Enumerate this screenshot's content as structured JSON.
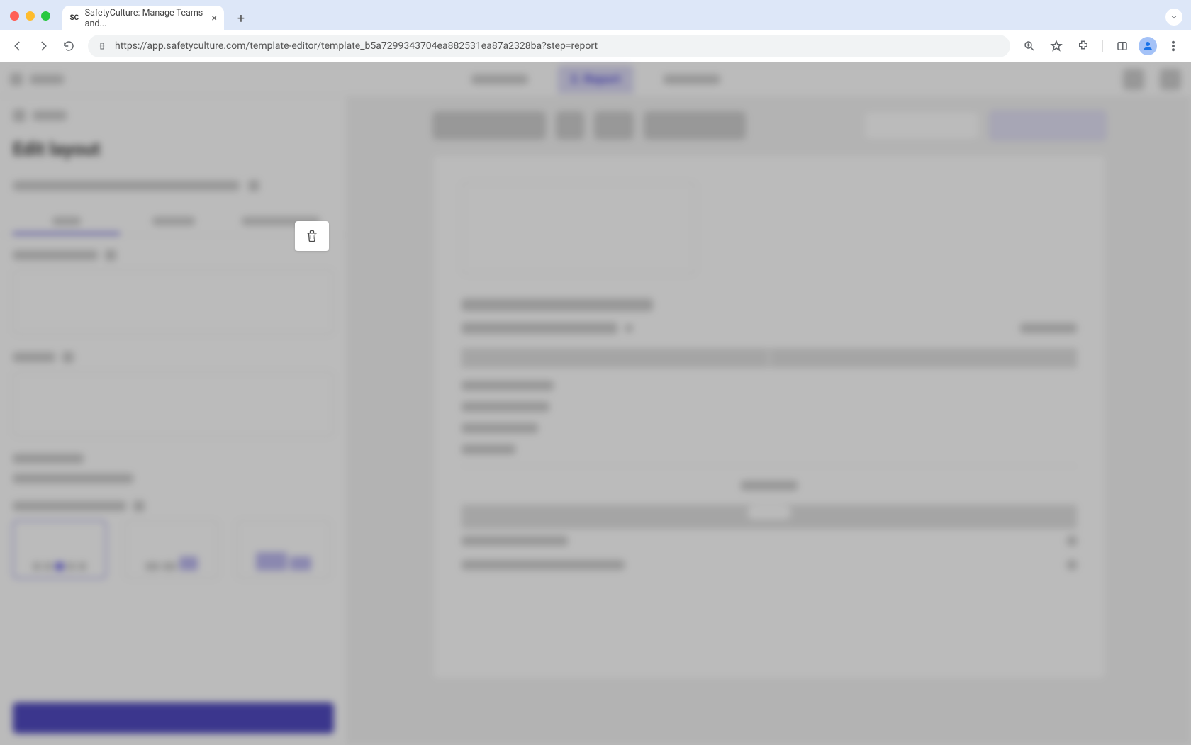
{
  "browser": {
    "tab_title": "SafetyCulture: Manage Teams and...",
    "favicon_text": "SC",
    "url": "https://app.safetyculture.com/template-editor/template_b5a7299343704ea882531ea87a2328ba?step=report"
  },
  "app": {
    "active_step_label": "2. Report",
    "sidebar_title": "Edit layout"
  }
}
